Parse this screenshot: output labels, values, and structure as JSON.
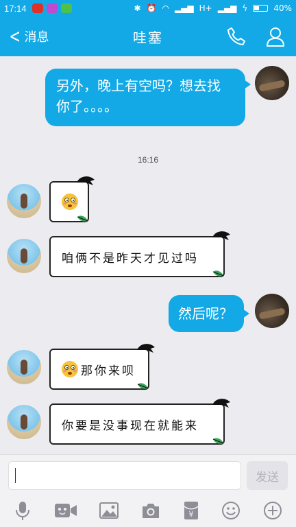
{
  "status_bar": {
    "time": "17:14",
    "network": "H+",
    "battery": "40%"
  },
  "nav": {
    "back_label": "消息",
    "title": "哇塞",
    "icons": [
      "phone-icon",
      "contact-profile-icon"
    ]
  },
  "messages": [
    {
      "from": "me",
      "text_line1": "另外，晚上有空吗？想去找",
      "text_line2": "你了。。。。"
    },
    {
      "timestamp": "16:16"
    },
    {
      "from": "them",
      "emoji": "flushed-face-emoji"
    },
    {
      "from": "them",
      "text": "咱俩不是昨天才见过吗"
    },
    {
      "from": "me",
      "text": "然后呢？"
    },
    {
      "from": "them",
      "emoji": "flushed-face-emoji",
      "text": "那你来呗"
    },
    {
      "from": "them",
      "text": "你要是没事现在就能来"
    }
  ],
  "input": {
    "value": "",
    "send_label": "发送"
  },
  "toolbar": {
    "icons": [
      "microphone-icon",
      "video-call-icon",
      "image-icon",
      "camera-icon",
      "red-packet-icon",
      "emoji-icon",
      "plus-icon"
    ]
  },
  "colors": {
    "accent": "#12a9e6",
    "chat_background": "#ebebf0",
    "my_bubble": "#12a9e6"
  }
}
